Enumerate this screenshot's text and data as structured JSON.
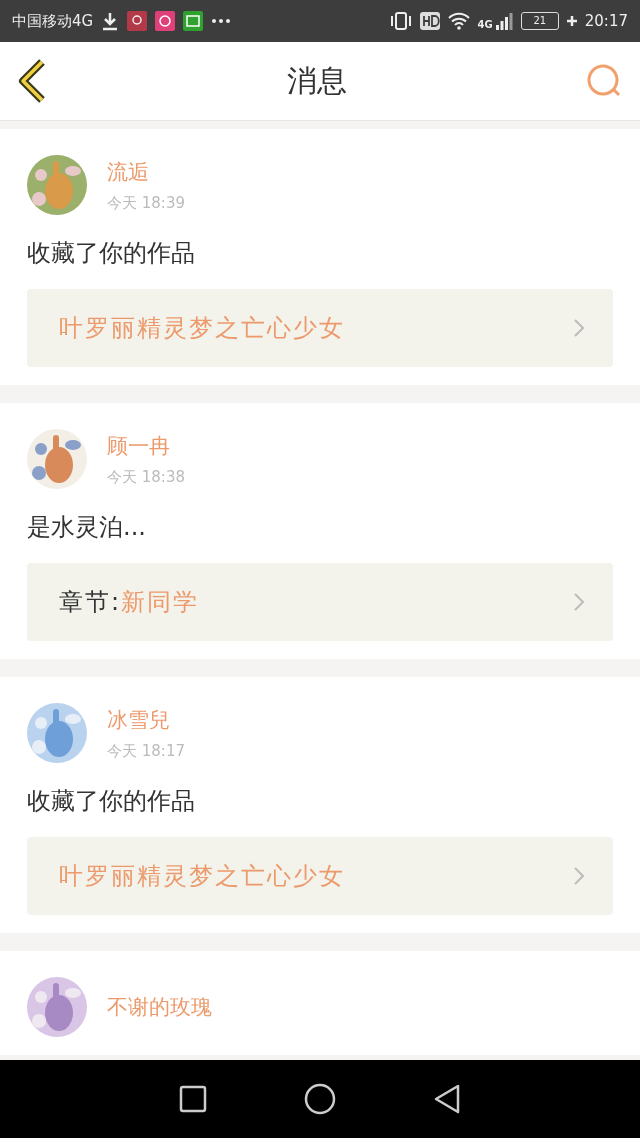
{
  "status_bar": {
    "carrier": "中国移动4G",
    "network": "4G",
    "battery": "21",
    "time": "20:17"
  },
  "header": {
    "title": "消息"
  },
  "messages": [
    {
      "user": "流逅",
      "time": "今天 18:39",
      "text": "收藏了你的作品",
      "link": {
        "kind": "work",
        "title": "叶罗丽精灵梦之亡心少女"
      }
    },
    {
      "user": "顾一冉",
      "time": "今天 18:38",
      "text": "是水灵泊...",
      "link": {
        "kind": "chapter",
        "prefix": "章节:",
        "title": "新同学"
      }
    },
    {
      "user": "冰雪兒",
      "time": "今天 18:17",
      "text": "收藏了你的作品",
      "link": {
        "kind": "work",
        "title": "叶罗丽精灵梦之亡心少女"
      }
    },
    {
      "user": "不谢的玫瑰"
    }
  ]
}
